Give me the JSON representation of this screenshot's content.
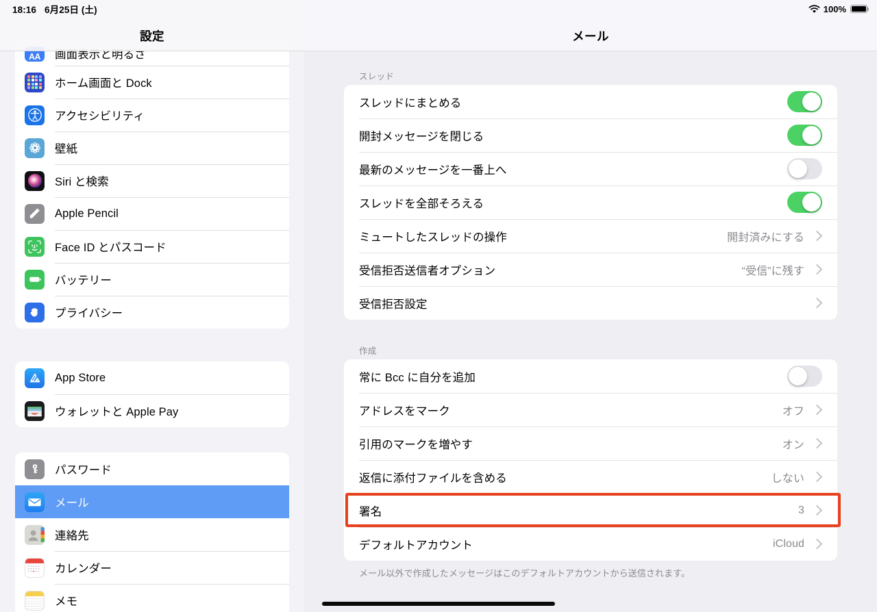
{
  "status_bar": {
    "time": "18:16",
    "date": "6月25日 (土)",
    "wifi_icon": "wifi-icon",
    "battery_percent": "100%",
    "battery_icon": "battery-full-icon"
  },
  "sidebar": {
    "title": "設定",
    "groups": [
      {
        "items": [
          {
            "label": "画面表示と明るさ",
            "icon": "display-brightness-icon",
            "selected": false,
            "clipped_top": true
          },
          {
            "label": "ホーム画面と Dock",
            "icon": "home-screen-dock-icon",
            "selected": false
          },
          {
            "label": "アクセシビリティ",
            "icon": "accessibility-icon",
            "selected": false
          },
          {
            "label": "壁紙",
            "icon": "wallpaper-icon",
            "selected": false
          },
          {
            "label": "Siri と検索",
            "icon": "siri-search-icon",
            "selected": false
          },
          {
            "label": "Apple Pencil",
            "icon": "apple-pencil-icon",
            "selected": false
          },
          {
            "label": "Face ID とパスコード",
            "icon": "face-id-icon",
            "selected": false
          },
          {
            "label": "バッテリー",
            "icon": "battery-icon",
            "selected": false
          },
          {
            "label": "プライバシー",
            "icon": "privacy-hand-icon",
            "selected": false
          }
        ]
      },
      {
        "items": [
          {
            "label": "App Store",
            "icon": "app-store-icon",
            "selected": false
          },
          {
            "label": "ウォレットと Apple Pay",
            "icon": "wallet-apple-pay-icon",
            "selected": false
          }
        ]
      },
      {
        "items": [
          {
            "label": "パスワード",
            "icon": "passwords-key-icon",
            "selected": false
          },
          {
            "label": "メール",
            "icon": "mail-icon",
            "selected": true
          },
          {
            "label": "連絡先",
            "icon": "contacts-icon",
            "selected": false
          },
          {
            "label": "カレンダー",
            "icon": "calendar-icon",
            "selected": false
          },
          {
            "label": "メモ",
            "icon": "notes-icon",
            "selected": false
          }
        ]
      }
    ]
  },
  "detail": {
    "title": "メール",
    "sections": [
      {
        "header": "スレッド",
        "rows": [
          {
            "label": "スレッドにまとめる",
            "control": "switch",
            "on": true
          },
          {
            "label": "開封メッセージを閉じる",
            "control": "switch",
            "on": true
          },
          {
            "label": "最新のメッセージを一番上へ",
            "control": "switch",
            "on": false
          },
          {
            "label": "スレッドを全部そろえる",
            "control": "switch",
            "on": true
          },
          {
            "label": "ミュートしたスレッドの操作",
            "control": "disclosure",
            "value": "開封済みにする"
          },
          {
            "label": "受信拒否送信者オプション",
            "control": "disclosure",
            "value": "“受信”に残す"
          },
          {
            "label": "受信拒否設定",
            "control": "disclosure",
            "value": ""
          }
        ]
      },
      {
        "header": "作成",
        "rows": [
          {
            "label": "常に Bcc に自分を追加",
            "control": "switch",
            "on": false
          },
          {
            "label": "アドレスをマーク",
            "control": "disclosure",
            "value": "オフ"
          },
          {
            "label": "引用のマークを増やす",
            "control": "disclosure",
            "value": "オン"
          },
          {
            "label": "返信に添付ファイルを含める",
            "control": "disclosure",
            "value": "しない"
          },
          {
            "label": "署名",
            "control": "disclosure",
            "value": "3",
            "highlighted": true
          },
          {
            "label": "デフォルトアカウント",
            "control": "disclosure",
            "value": "iCloud"
          }
        ],
        "footnote": "メール以外で作成したメッセージはこのデフォルトアカウントから送信されます。"
      }
    ]
  },
  "annotation": {
    "type": "red-rectangle-highlight",
    "target_label": "署名",
    "color": "#e8401f"
  },
  "home_indicator": "home-indicator"
}
